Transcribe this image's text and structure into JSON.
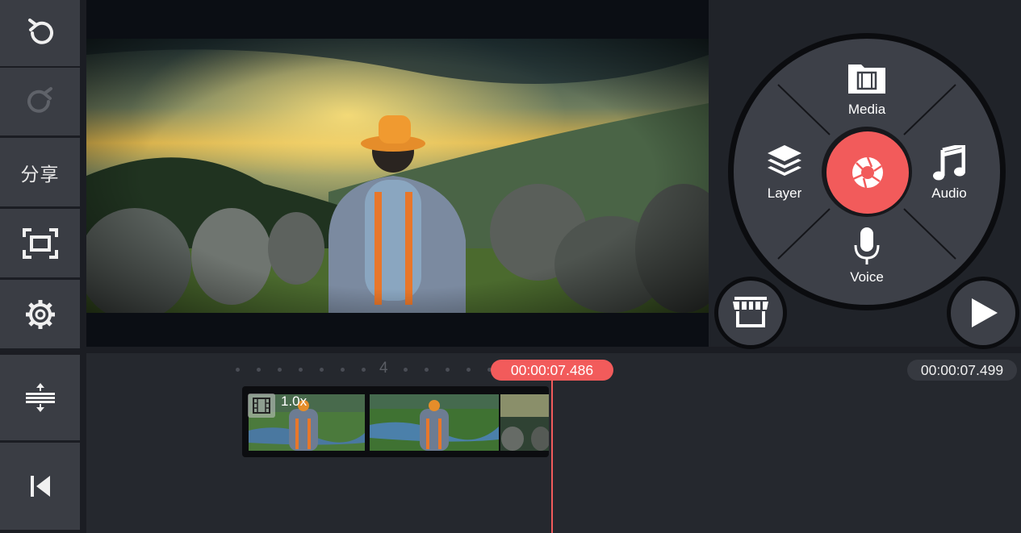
{
  "app": {
    "accent_color": "#f25b5b",
    "toolbar_color": "#3a3d44"
  },
  "toolbar": {
    "undo_icon": "undo-icon",
    "redo_icon": "redo-icon",
    "share_label": "分享",
    "fullscreen_icon": "fullscreen-icon",
    "settings_icon": "gear-icon",
    "adjust_icon": "timeline-expand-icon",
    "rewind_icon": "skip-to-start-icon"
  },
  "media_wheel": {
    "center_icon": "camera-shutter-icon",
    "items": [
      {
        "label": "Media",
        "icon": "film-folder-icon"
      },
      {
        "label": "Layer",
        "icon": "layers-icon"
      },
      {
        "label": "Audio",
        "icon": "music-note-icon"
      },
      {
        "label": "Voice",
        "icon": "microphone-icon"
      }
    ]
  },
  "store_icon": "store-icon",
  "play_icon": "play-icon",
  "timeline": {
    "playhead_time": "00:00:07.486",
    "total_time": "00:00:07.499",
    "ruler_label": "4",
    "clip_speed": "1.0x"
  }
}
